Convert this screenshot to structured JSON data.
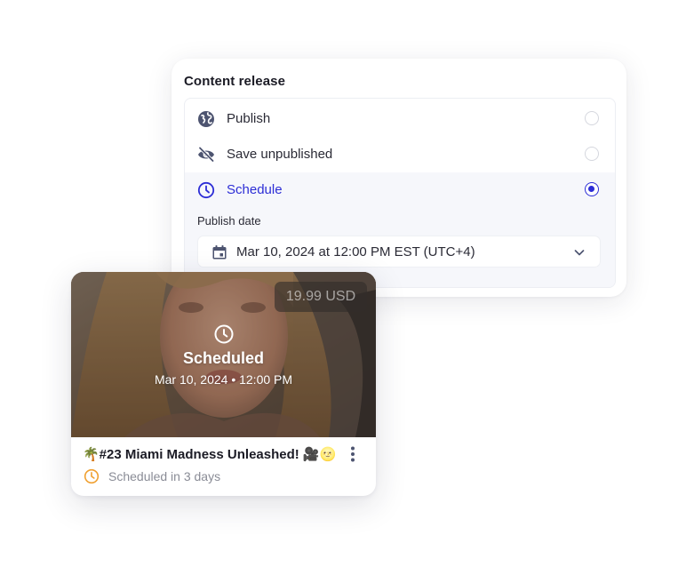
{
  "release": {
    "title": "Content release",
    "options": [
      {
        "label": "Publish",
        "icon": "globe-icon",
        "selected": false
      },
      {
        "label": "Save unpublished",
        "icon": "eye-off-icon",
        "selected": false
      },
      {
        "label": "Schedule",
        "icon": "clock-icon",
        "selected": true
      }
    ],
    "publish_date_label": "Publish date",
    "publish_date_value": "Mar 10, 2024 at 12:00 PM EST (UTC+4)",
    "accent_color": "#2d2ed6"
  },
  "post": {
    "price": "19.99 USD",
    "overlay_status": "Scheduled",
    "overlay_datetime": "Mar 10, 2024 • 12:00 PM",
    "title": "🌴#23 Miami Madness Unleashed! 🎥🌝",
    "status_text": "Scheduled in 3 days",
    "status_color": "#f0a030"
  }
}
